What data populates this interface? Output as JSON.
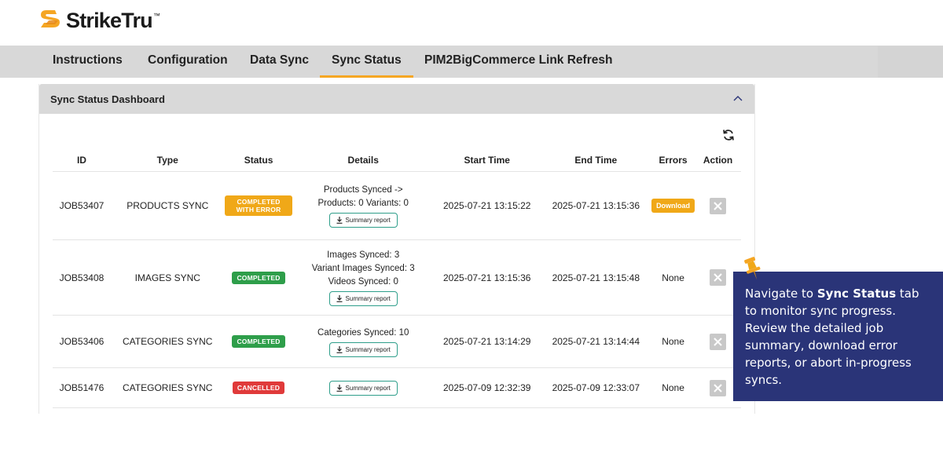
{
  "logo": {
    "name": "StrikeTru",
    "tm": "™"
  },
  "tabs": [
    {
      "label": "Instructions"
    },
    {
      "label": "Configuration"
    },
    {
      "label": "Data Sync"
    },
    {
      "label": "Sync Status",
      "active": true
    },
    {
      "label": "PIM2BigCommerce Link Refresh"
    }
  ],
  "dashboard": {
    "title": "Sync Status Dashboard",
    "columns": [
      "ID",
      "Type",
      "Status",
      "Details",
      "Start Time",
      "End Time",
      "Errors",
      "Action"
    ],
    "report_label": "Summary report",
    "download_label": "Download",
    "rows": [
      {
        "id": "JOB53407",
        "type": "PRODUCTS SYNC",
        "status": "COMPLETED WITH ERROR",
        "details": [
          "Products Synced ->",
          "Products: 0 Variants: 0"
        ],
        "start": "2025-07-21 13:15:22",
        "end": "2025-07-21 13:15:36",
        "errors": "Download"
      },
      {
        "id": "JOB53408",
        "type": "IMAGES SYNC",
        "status": "COMPLETED",
        "details": [
          "Images Synced: 3",
          "Variant Images Synced: 3",
          "Videos Synced: 0"
        ],
        "start": "2025-07-21 13:15:36",
        "end": "2025-07-21 13:15:48",
        "errors": "None"
      },
      {
        "id": "JOB53406",
        "type": "CATEGORIES SYNC",
        "status": "COMPLETED",
        "details": [
          "Categories Synced: 10"
        ],
        "start": "2025-07-21 13:14:29",
        "end": "2025-07-21 13:14:44",
        "errors": "None"
      },
      {
        "id": "JOB51476",
        "type": "CATEGORIES SYNC",
        "status": "CANCELLED",
        "details": [],
        "start": "2025-07-09 12:32:39",
        "end": "2025-07-09 12:33:07",
        "errors": "None"
      }
    ]
  },
  "callout": {
    "pre": "Navigate to ",
    "bold": "Sync Status",
    "post": " tab to monitor sync progress. Review the detailed job summary, download error reports, or abort in-progress syncs."
  },
  "colors": {
    "accent": "#f5a623",
    "tabbar": "#d8d8d8",
    "callout_bg": "#2a3478",
    "completed": "#2e9e4a",
    "warning": "#f0a818",
    "cancelled": "#e03a3a"
  }
}
